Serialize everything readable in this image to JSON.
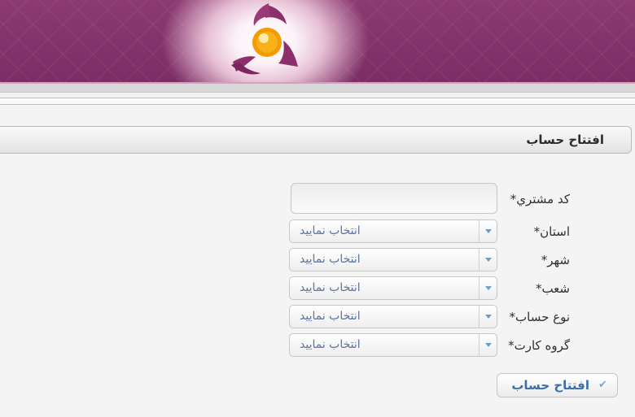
{
  "header": {
    "logo_icon": "bank-emblem-icon",
    "background_color": "#7c2d65",
    "accent_color": "#f2a500"
  },
  "panel": {
    "title": "افتتاح حساب"
  },
  "form": {
    "customer_code": {
      "label": "کد مشتري*",
      "value": ""
    },
    "province": {
      "label": "استان*",
      "selected": "انتخاب نمایید"
    },
    "city": {
      "label": "شهر*",
      "selected": "انتخاب نمایید"
    },
    "branch": {
      "label": "شعب*",
      "selected": "انتخاب نمایید"
    },
    "account_type": {
      "label": "نوع حساب*",
      "selected": "انتخاب نمایید"
    },
    "card_group": {
      "label": "گروه کارت*",
      "selected": "انتخاب نمایید"
    },
    "submit": {
      "label": "افتتاح حساب",
      "icon": "check-icon"
    }
  }
}
